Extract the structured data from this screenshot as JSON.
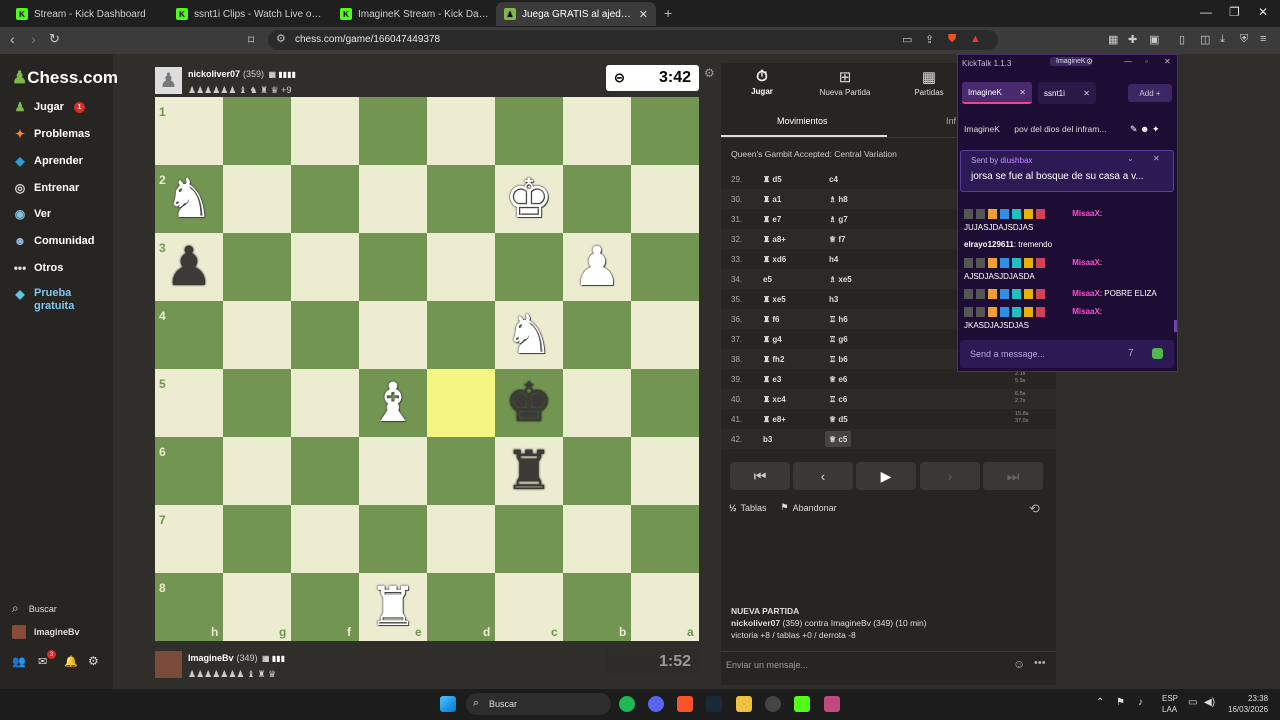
{
  "browser": {
    "tabs": [
      {
        "label": "Stream - Kick Dashboard",
        "icon": "kick-icon",
        "active": false
      },
      {
        "label": "ssnt1i Clips - Watch Live on Kick",
        "icon": "kick-icon",
        "active": false
      },
      {
        "label": "ImagineK Stream - Kick Dashboard",
        "icon": "kick-icon",
        "active": false
      },
      {
        "label": "Juega GRATIS al ajedrez online -",
        "icon": "chess-icon",
        "active": true
      }
    ],
    "url": "chess.com/game/166047449378"
  },
  "sidebar": {
    "logo": "Chess.com",
    "items": [
      {
        "label": "Jugar",
        "icon": "pawn-icon",
        "color": "#81b64c",
        "badge": "1"
      },
      {
        "label": "Problemas",
        "icon": "puzzle-icon",
        "color": "#f0833a"
      },
      {
        "label": "Aprender",
        "icon": "graduation-icon",
        "color": "#27a0d8"
      },
      {
        "label": "Entrenar",
        "icon": "target-icon",
        "color": "#dddddd"
      },
      {
        "label": "Ver",
        "icon": "binoculars-icon",
        "color": "#81c0e0"
      },
      {
        "label": "Comunidad",
        "icon": "community-icon",
        "color": "#9bd"
      },
      {
        "label": "Otros",
        "icon": "more-icon",
        "color": "#dddddd"
      },
      {
        "label": "Prueba gratuita",
        "icon": "diamond-icon",
        "color": "#5bc8e8"
      }
    ],
    "search_label": "Buscar",
    "user": "ImagineBv",
    "mail_badge": "3"
  },
  "game": {
    "top_player": {
      "name": "nickoliver07",
      "rating": "(359)",
      "captured": "♟♟♟♟♟♟ ♝ ♞ ♜ ♛ +9"
    },
    "top_clock": "3:42",
    "bottom_player": {
      "name": "ImagineBv",
      "rating": "(349)",
      "captured": "♟♟♟♟♟♟♟ ♝ ♜ ♛"
    },
    "bottom_clock": "1:52",
    "ranks": [
      "1",
      "2",
      "3",
      "4",
      "5",
      "6",
      "7",
      "8"
    ],
    "files": [
      "h",
      "g",
      "f",
      "e",
      "d",
      "c",
      "b",
      "a"
    ]
  },
  "panel": {
    "tabs": [
      {
        "label": "Jugar",
        "icon": "stopwatch-icon"
      },
      {
        "label": "Nueva Partida",
        "icon": "plus-icon"
      },
      {
        "label": "Partidas",
        "icon": "board-icon"
      }
    ],
    "subtabs": [
      "Movimientos",
      "Inf"
    ],
    "opening": "Queen's Gambit Accepted: Central Variation",
    "moves": [
      {
        "n": "29.",
        "w": "♜ d5",
        "b": "c4",
        "t1": "",
        "t2": ""
      },
      {
        "n": "30.",
        "w": "♜ a1",
        "b": "♗ h8",
        "t1": "",
        "t2": ""
      },
      {
        "n": "31.",
        "w": "♜ e7",
        "b": "♗ g7",
        "t1": "",
        "t2": ""
      },
      {
        "n": "32.",
        "w": "♜ a8+",
        "b": "♕ f7",
        "t1": "",
        "t2": ""
      },
      {
        "n": "33.",
        "w": "♜ xd6",
        "b": "h4",
        "t1": "",
        "t2": ""
      },
      {
        "n": "34.",
        "w": "e5",
        "b": "♗ xe5",
        "t1": "",
        "t2": ""
      },
      {
        "n": "35.",
        "w": "♜ xe5",
        "b": "h3",
        "t1": "",
        "t2": ""
      },
      {
        "n": "36.",
        "w": "♜ f6",
        "b": "♖ h6",
        "t1": "",
        "t2": ""
      },
      {
        "n": "37.",
        "w": "♜ g4",
        "b": "♖ g6",
        "t1": "",
        "t2": ""
      },
      {
        "n": "38.",
        "w": "♜ fh2",
        "b": "♖ b6",
        "t1": "10.2s",
        "t2": "5.0s"
      },
      {
        "n": "39.",
        "w": "♜ e3",
        "b": "♕ e6",
        "t1": "2.1s",
        "t2": "5.9s"
      },
      {
        "n": "40.",
        "w": "♜ xc4",
        "b": "♖ c6",
        "t1": "6.5s",
        "t2": "2.7s"
      },
      {
        "n": "41.",
        "w": "♜ e8+",
        "b": "♕ d5",
        "t1": "15.8s",
        "t2": "37.0s"
      },
      {
        "n": "42.",
        "w": "b3",
        "b": "♕ c5",
        "t1": "",
        "t2": ""
      }
    ],
    "draw": "Tablas",
    "resign": "Abandonar",
    "newgame": {
      "title": "NUEVA PARTIDA",
      "line1_name": "nickoliver07",
      "line1_rest": "(359) contra ImagineBv (349) (10 min)",
      "line2": "victoria +8 / tablas +0 / derrota -8"
    },
    "chat_placeholder": "Enviar un mensaje..."
  },
  "kicktalk": {
    "title": "KickTalk 1.1.3",
    "profile": "ImagineK",
    "chat_tabs": [
      "ImagineK",
      "ssnt1i"
    ],
    "add": "Add",
    "stream_user": "ImagineK",
    "stream_title": "pov del dios del infram...",
    "pinned_by": "Sent by",
    "pinned_user": "diushbax",
    "pinned_msg": "jorsa se fue al bosque de su casa a v...",
    "messages": [
      {
        "user": "MisaaX",
        "text": "JUJASJDAJSDJAS"
      },
      {
        "user": "elrayo129611",
        "text": "tremendo"
      },
      {
        "user": "MisaaX",
        "text": "AJSDJASJDJASDA"
      },
      {
        "user": "MisaaX",
        "text": "POBRE ELIZA"
      },
      {
        "user": "MisaaX",
        "text": "JKASDJAJSDJAS"
      }
    ],
    "send_placeholder": "Send a message..."
  },
  "taskbar": {
    "search": "Buscar",
    "lang": "ESP",
    "lang2": "LAA",
    "time": "23:38",
    "date": "16/03/2026"
  }
}
